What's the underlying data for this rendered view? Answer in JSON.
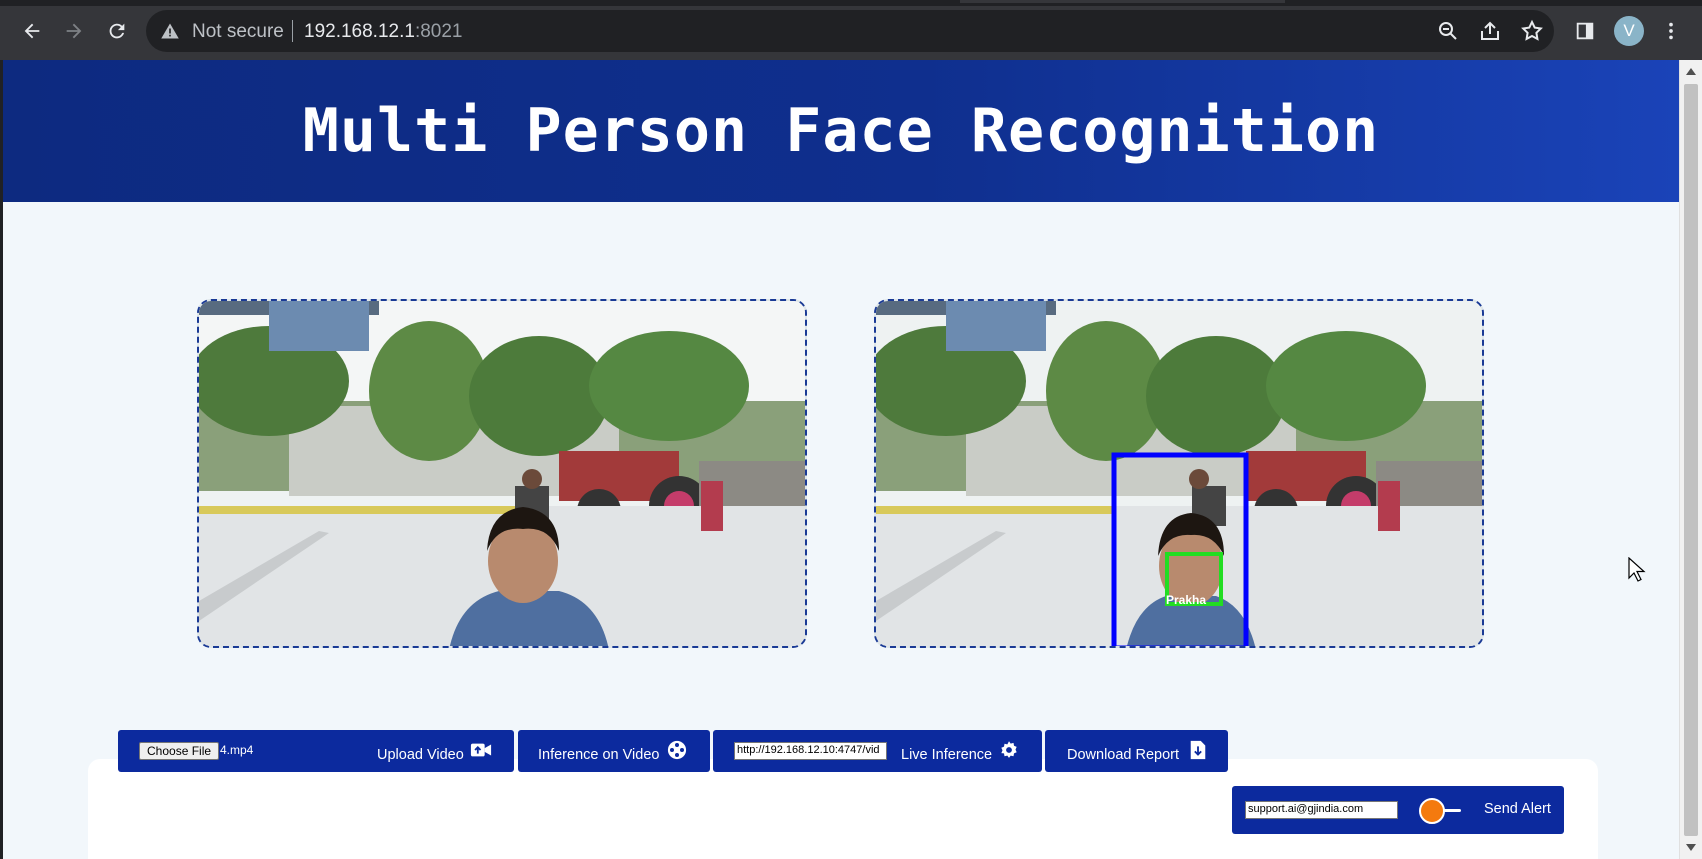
{
  "browser": {
    "not_secure_label": "Not secure",
    "host": "192.168.12.1",
    "port": ":8021",
    "avatar_letter": "V"
  },
  "page": {
    "title": "Multi Person Face Recognition"
  },
  "videos": {
    "input_alt": "Input video frame",
    "output_alt": "Inference output frame",
    "detection_label": "Prakha"
  },
  "toolbar": {
    "choose_file_label": "Choose File",
    "chosen_file": "4.mp4",
    "upload_label": "Upload Video",
    "inference_label": "Inference on Video",
    "stream_url": "http://192.168.12.10:4747/vid",
    "live_label": "Live Inference",
    "report_label": "Download Report",
    "alert_email": "support.ai@gjindia.com",
    "alert_label": "Send Alert"
  },
  "colors": {
    "header_bg": "#0f2f8e",
    "button_bg": "#0c2a9e",
    "toggle_knob": "#f47a0e",
    "person_box": "#0000ff",
    "face_box": "#22dd22"
  }
}
